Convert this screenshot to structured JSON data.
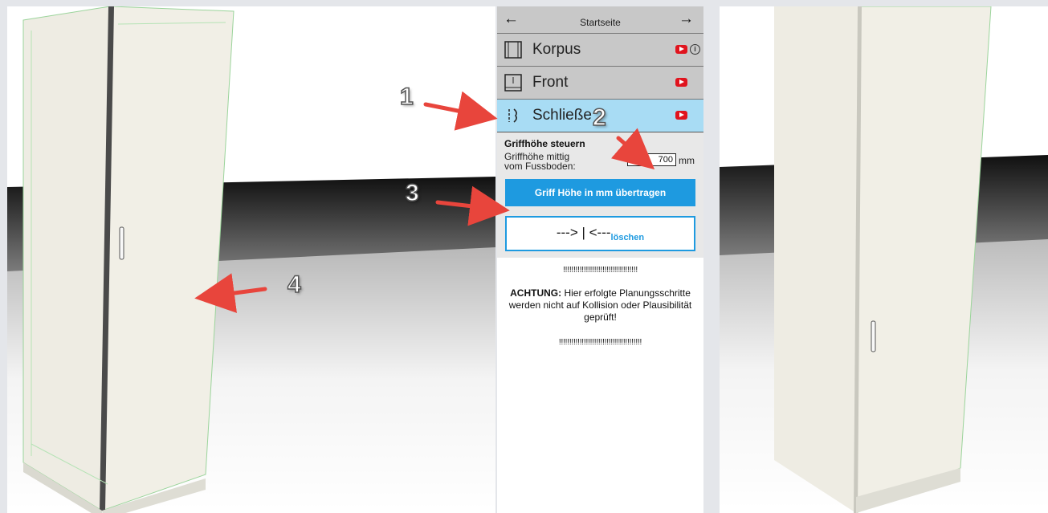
{
  "nav": {
    "back_icon": "arrow-left-icon",
    "forward_icon": "arrow-right-icon",
    "title": "Startseite"
  },
  "menu": [
    {
      "label": "Korpus",
      "icon": "cabinet-body-icon",
      "video": true,
      "info": true
    },
    {
      "label": "Front",
      "icon": "front-panel-icon",
      "video": true,
      "info": false
    },
    {
      "label": "Schließe",
      "icon": "lock-icon",
      "video": true,
      "info": false,
      "active": true
    }
  ],
  "handle_section": {
    "title": "Griffhöhe steuern",
    "field_label_line1": "Griffhöhe mittig",
    "field_label_line2": "vom Fussboden:",
    "height_value": "700",
    "unit": "mm",
    "apply_button": "Griff Höhe in mm übertragen",
    "clear_arrows": "---> | <---",
    "clear_label": "löschen"
  },
  "notice": {
    "bangs_top": "!!!!!!!!!!!!!!!!!!!!!!!!!!!!!!!!!!!!",
    "warning_bold": "ACHTUNG:",
    "warning_text": " Hier erfolgte Planungsschritte werden nicht auf Kollision oder Plausibilität geprüft!",
    "bangs_bottom": "!!!!!!!!!!!!!!!!!!!!!!!!!!!!!!!!!!!!!!!!"
  },
  "annotations": [
    "1",
    "2",
    "3",
    "4"
  ],
  "colors": {
    "accent": "#1e9ae0",
    "active_menu": "#a8dcf4",
    "annotation_arrow": "#e8453c",
    "youtube": "#e0141e"
  }
}
